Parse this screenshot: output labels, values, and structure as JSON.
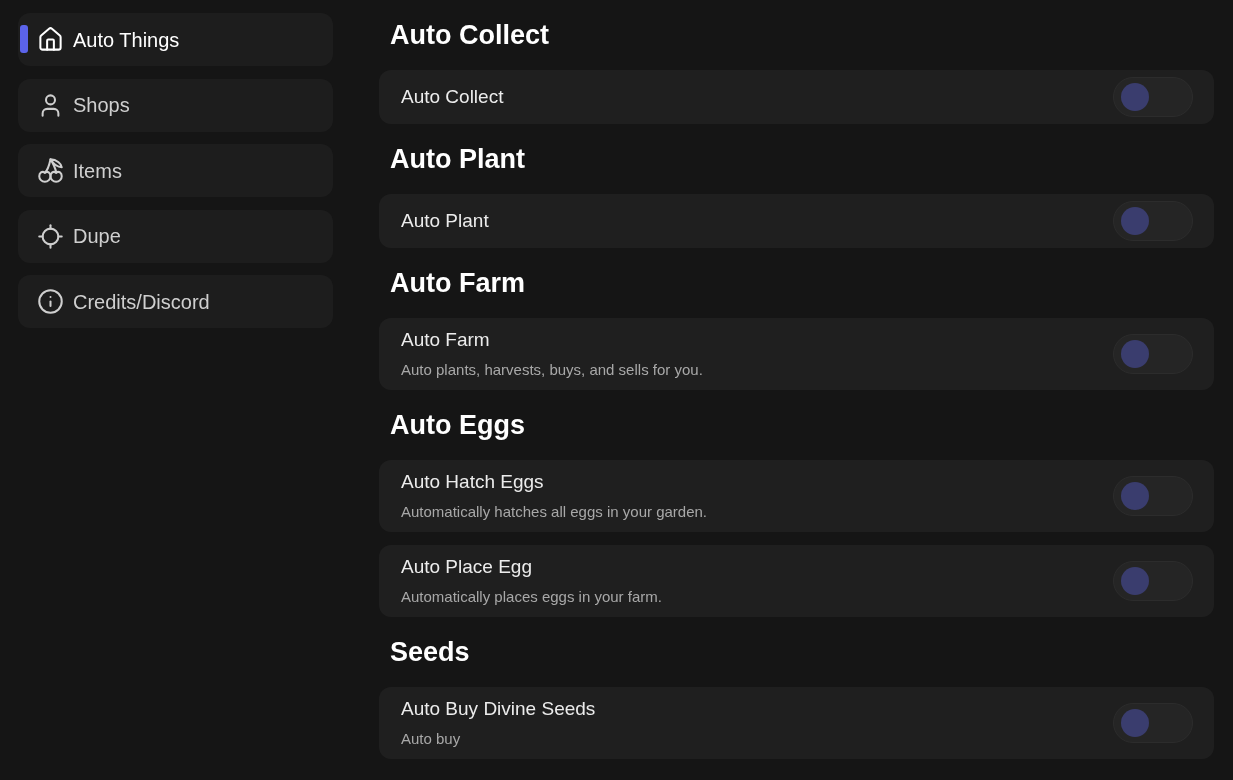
{
  "sidebar": {
    "items": [
      {
        "label": "Auto Things",
        "selected": true
      },
      {
        "label": "Shops",
        "selected": false
      },
      {
        "label": "Items",
        "selected": false
      },
      {
        "label": "Dupe",
        "selected": false
      },
      {
        "label": "Credits/Discord",
        "selected": false
      }
    ]
  },
  "sections": [
    {
      "title": "Auto Collect",
      "toggles": [
        {
          "label": "Auto Collect",
          "on": false
        }
      ]
    },
    {
      "title": "Auto Plant",
      "toggles": [
        {
          "label": "Auto Plant",
          "on": false
        }
      ]
    },
    {
      "title": "Auto Farm",
      "toggles": [
        {
          "label": "Auto Farm",
          "description": "Auto plants, harvests, buys, and sells for you.",
          "on": false
        }
      ]
    },
    {
      "title": "Auto Eggs",
      "toggles": [
        {
          "label": "Auto Hatch Eggs",
          "description": "Automatically hatches all eggs in your garden.",
          "on": false
        },
        {
          "label": "Auto Place Egg",
          "description": "Automatically places eggs in your farm.",
          "on": false
        }
      ]
    },
    {
      "title": "Seeds",
      "toggles": [
        {
          "label": "Auto Buy Divine Seeds",
          "description": "Auto buy",
          "on": false
        }
      ]
    }
  ]
}
